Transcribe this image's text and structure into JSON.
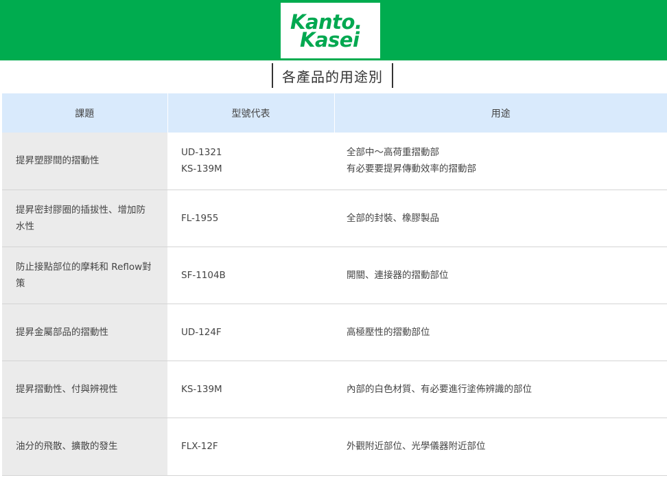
{
  "logo": {
    "line1": "Kanto.",
    "line2": "Kasei"
  },
  "page_title": "各產品的用途別",
  "table": {
    "headers": [
      "課題",
      "型號代表",
      "用途"
    ],
    "rows": [
      {
        "issue": "提昇塑膠間的摺動性",
        "models": [
          "UD-1321",
          "KS-139M"
        ],
        "uses": [
          "全部中～高荷重摺動部",
          "有必要要提昇傳動效率的摺動部"
        ]
      },
      {
        "issue": "提昇密封膠圈的插拔性、增加防水性",
        "models": [
          "FL-1955"
        ],
        "uses": [
          "全部的封裝、橡膠製品"
        ]
      },
      {
        "issue": "防止接點部位的摩耗和 Reflow對策",
        "models": [
          "SF-1104B"
        ],
        "uses": [
          "開關、連接器的摺動部位"
        ]
      },
      {
        "issue": "提昇金屬部品的摺動性",
        "models": [
          "UD-124F"
        ],
        "uses": [
          "高極壓性的摺動部位"
        ]
      },
      {
        "issue": "提昇摺動性、付與辨視性",
        "models": [
          "KS-139M"
        ],
        "uses": [
          "內部的白色材質、有必要進行塗佈辨識的部位"
        ]
      },
      {
        "issue": "油分的飛散、擴散的發生",
        "models": [
          "FLX-12F"
        ],
        "uses": [
          "外觀附近部位、光學儀器附近部位"
        ]
      }
    ]
  },
  "colors": {
    "header_green": "#00ac4f",
    "logo_green": "#00a850",
    "table_header_bg": "#d9eafc",
    "first_col_bg": "#ebebeb"
  }
}
